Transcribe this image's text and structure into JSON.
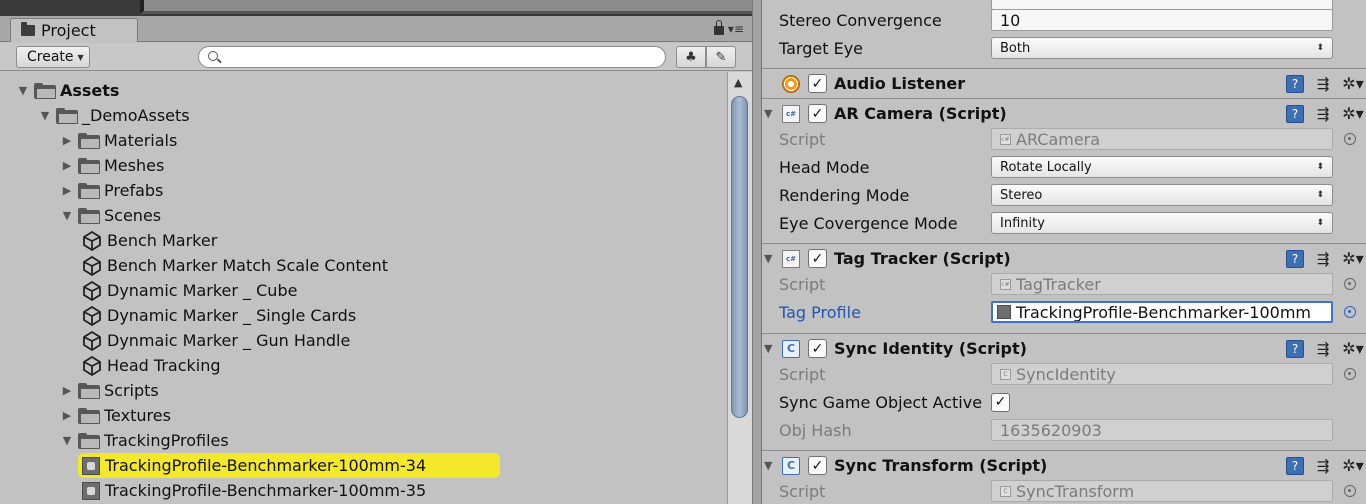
{
  "project": {
    "tab_label": "Project",
    "create_label": "Create",
    "search_value": "",
    "tree": [
      {
        "label": "Assets",
        "level": 0,
        "kind": "folder",
        "expanded": true,
        "bold": true
      },
      {
        "label": "_DemoAssets",
        "level": 1,
        "kind": "folder",
        "expanded": true
      },
      {
        "label": "Materials",
        "level": 2,
        "kind": "folder",
        "expanded": false
      },
      {
        "label": "Meshes",
        "level": 2,
        "kind": "folder",
        "expanded": false
      },
      {
        "label": "Prefabs",
        "level": 2,
        "kind": "folder",
        "expanded": false
      },
      {
        "label": "Scenes",
        "level": 2,
        "kind": "folder",
        "expanded": true
      },
      {
        "label": "Bench Marker",
        "level": 3,
        "kind": "scene"
      },
      {
        "label": "Bench Marker Match Scale Content",
        "level": 3,
        "kind": "scene"
      },
      {
        "label": "Dynamic Marker _ Cube",
        "level": 3,
        "kind": "scene"
      },
      {
        "label": "Dynamic Marker _ Single Cards",
        "level": 3,
        "kind": "scene"
      },
      {
        "label": "Dynmaic Marker _ Gun Handle",
        "level": 3,
        "kind": "scene"
      },
      {
        "label": "Head Tracking",
        "level": 3,
        "kind": "scene"
      },
      {
        "label": "Scripts",
        "level": 2,
        "kind": "folder",
        "expanded": false
      },
      {
        "label": "Textures",
        "level": 2,
        "kind": "folder",
        "expanded": false
      },
      {
        "label": "TrackingProfiles",
        "level": 2,
        "kind": "folder",
        "expanded": true
      },
      {
        "label": "TrackingProfile-Benchmarker-100mm-34",
        "level": 3,
        "kind": "asset",
        "selected": true
      },
      {
        "label": "TrackingProfile-Benchmarker-100mm-35",
        "level": 3,
        "kind": "asset"
      }
    ]
  },
  "inspector": {
    "stereo_convergence_label": "Stereo Convergence",
    "stereo_convergence_value": "10",
    "target_eye_label": "Target Eye",
    "target_eye_value": "Both",
    "audio_listener_title": "Audio Listener",
    "ar_camera": {
      "title": "AR Camera (Script)",
      "script_label": "Script",
      "script_value": "ARCamera",
      "head_mode_label": "Head Mode",
      "head_mode_value": "Rotate Locally",
      "rendering_mode_label": "Rendering Mode",
      "rendering_mode_value": "Stereo",
      "eye_mode_label": "Eye Covergence Mode",
      "eye_mode_value": "Infinity"
    },
    "tag_tracker": {
      "title": "Tag Tracker (Script)",
      "script_label": "Script",
      "script_value": "TagTracker",
      "profile_label": "Tag Profile",
      "profile_value": "TrackingProfile-Benchmarker-100mm"
    },
    "sync_identity": {
      "title": "Sync Identity (Script)",
      "script_label": "Script",
      "script_value": "SyncIdentity",
      "active_label": "Sync Game Object Active",
      "active_checked": true,
      "hash_label": "Obj Hash",
      "hash_value": "1635620903"
    },
    "sync_transform": {
      "title": "Sync Transform (Script)",
      "script_label": "Script",
      "script_value": "SyncTransform"
    }
  },
  "colors": {
    "selection_highlight": "#f3e82a",
    "link_blue": "#1f56b5",
    "scroll_thumb": "#8fa6c2"
  }
}
